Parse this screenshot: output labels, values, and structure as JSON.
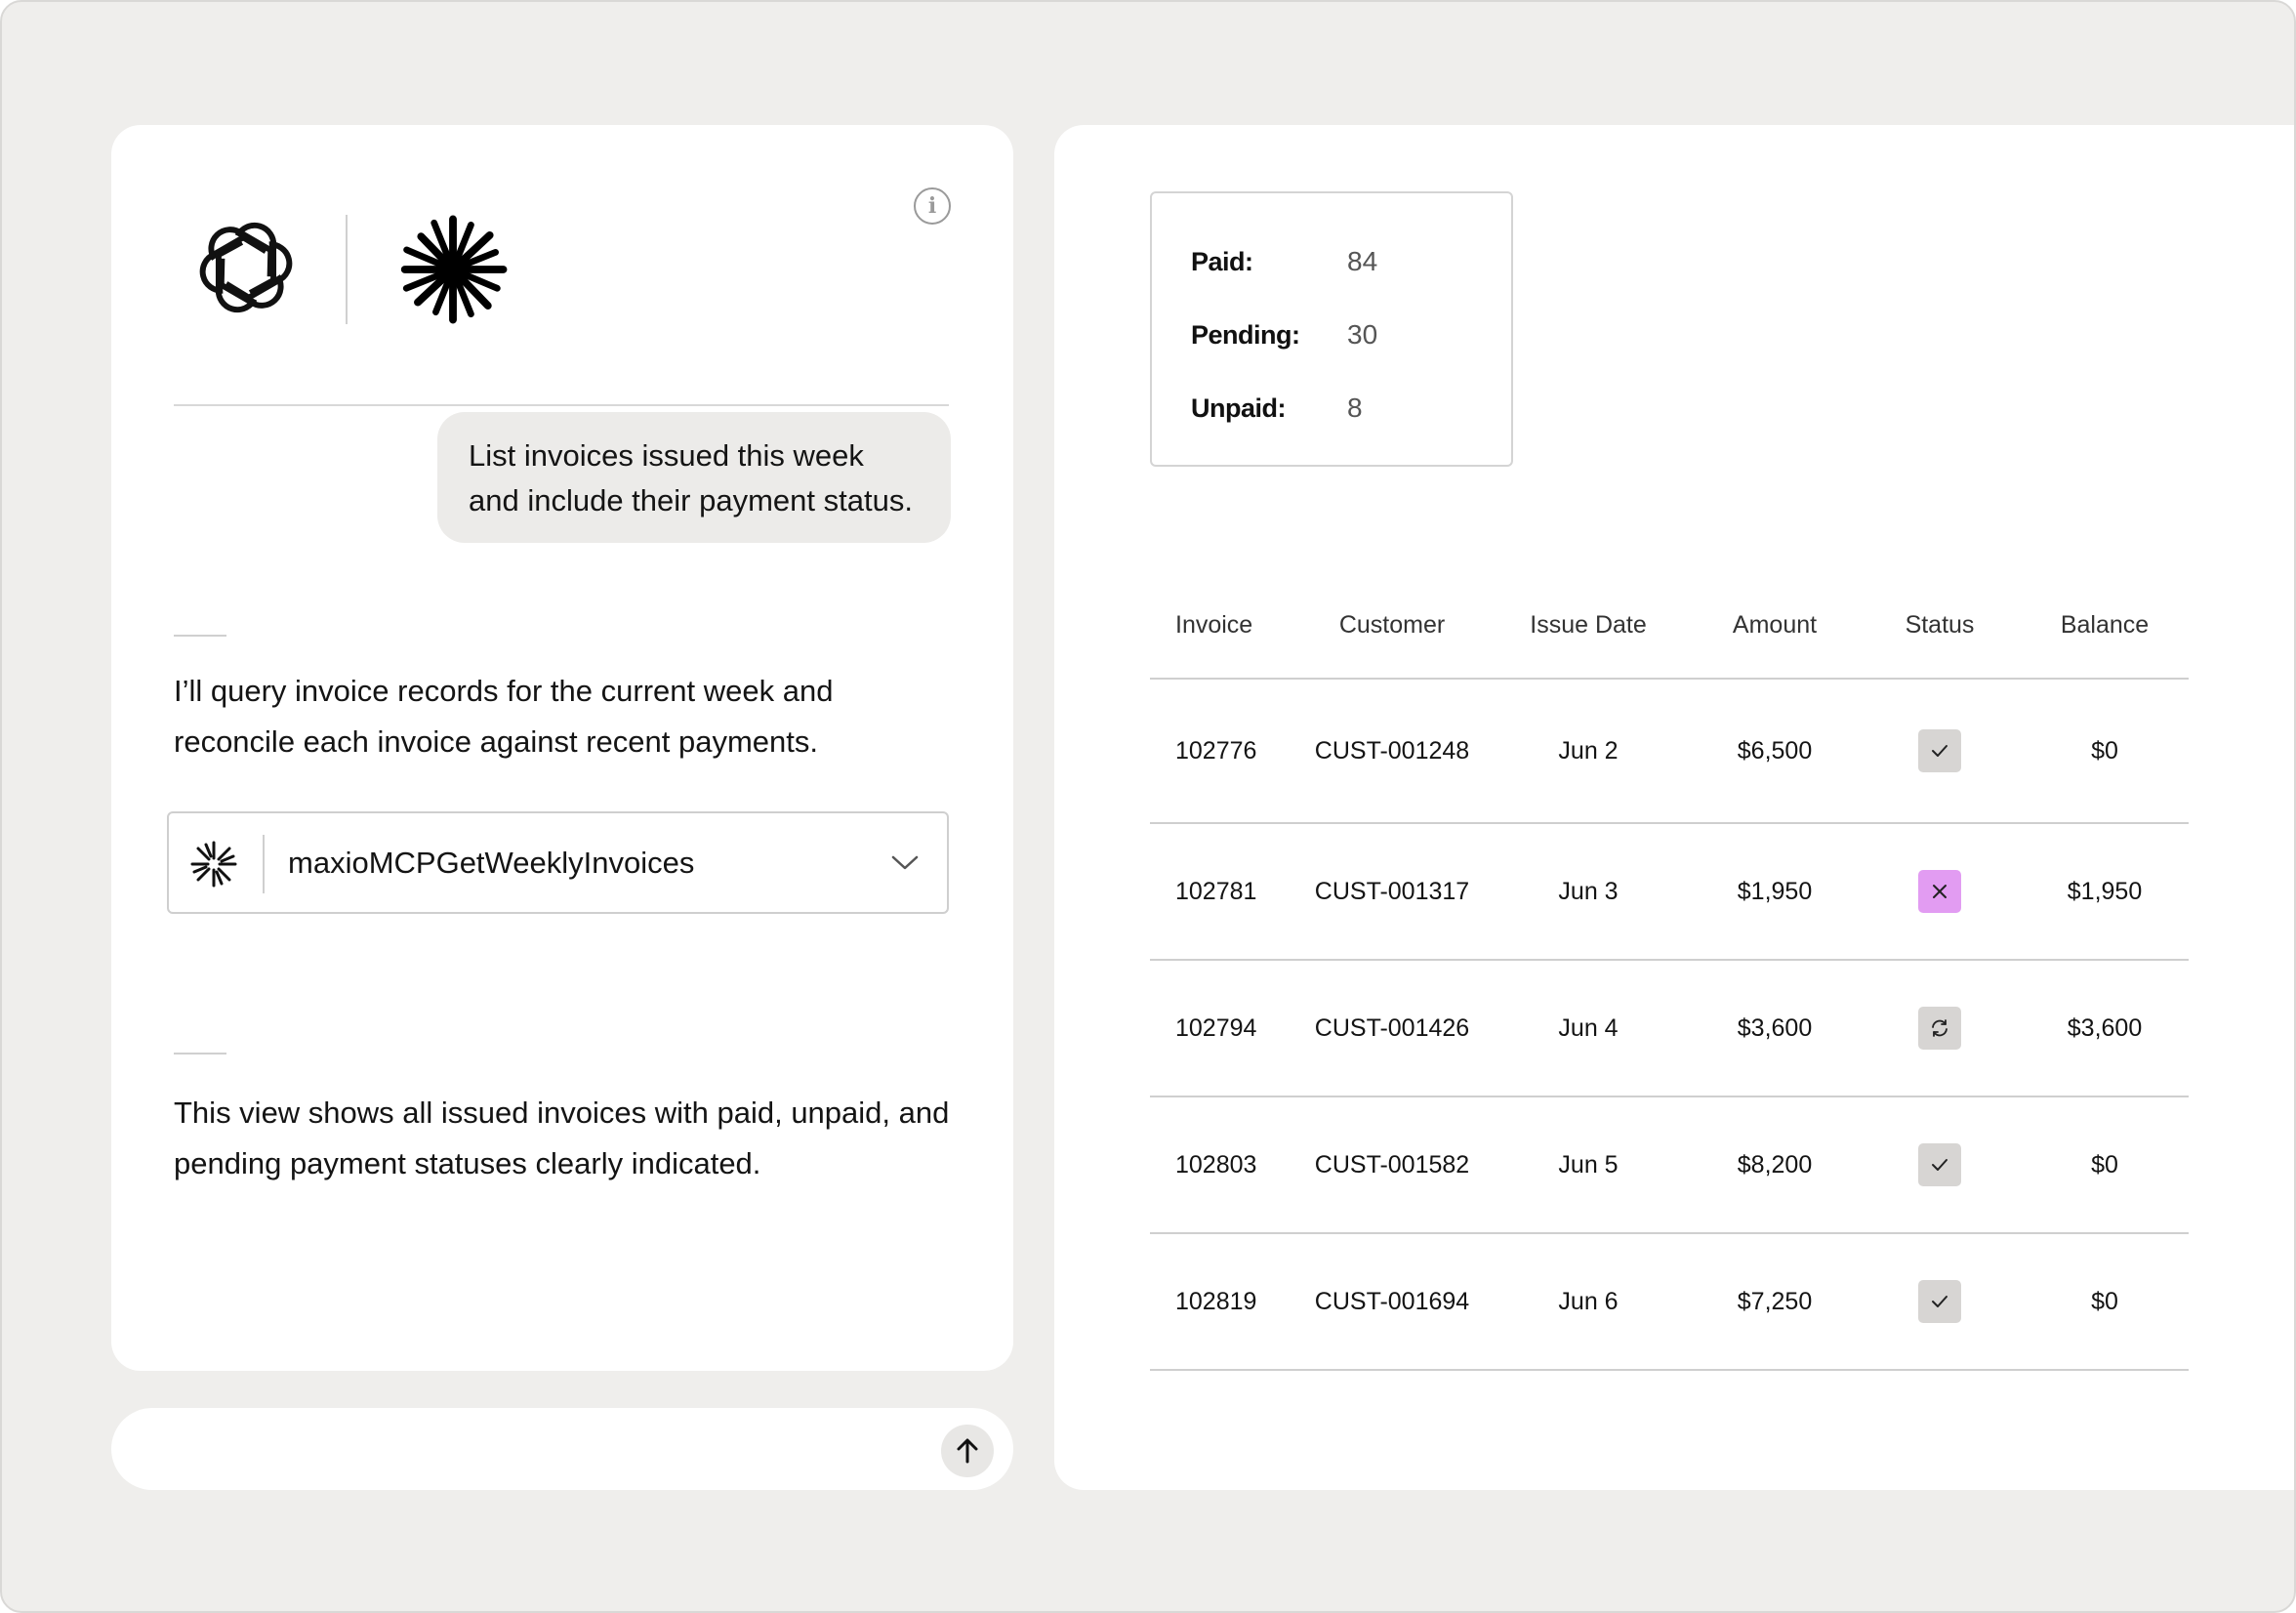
{
  "colors": {
    "frame_bg": "#efeeec",
    "panel_bg": "#ffffff",
    "bubble_bg": "#ecebe9",
    "status_paid": "#d7d5d3",
    "status_unpaid": "#e29cf2",
    "status_pending": "#d7d5d3"
  },
  "chat": {
    "logos": [
      "openai-logo",
      "claude-logo"
    ],
    "user_message": "List invoices issued this week and include their payment status.",
    "assistant_message_1": "I’ll query invoice records for the current week and reconcile each invoice against recent payments.",
    "tool_call": {
      "icon": "asterisk-icon",
      "name": "maxioMCPGetWeeklyInvoices",
      "chevron": "chevron-down-icon"
    },
    "assistant_message_2": "This view shows all issued invoices with paid, unpaid, and pending payment statuses clearly indicated."
  },
  "composer": {
    "value": "",
    "send_icon": "arrow-up-icon"
  },
  "summary": {
    "paid_label": "Paid:",
    "paid_value": "84",
    "pending_label": "Pending:",
    "pending_value": "30",
    "unpaid_label": "Unpaid:",
    "unpaid_value": "8"
  },
  "table": {
    "headers": [
      "Invoice",
      "Customer",
      "Issue Date",
      "Amount",
      "Status",
      "Balance"
    ],
    "rows": [
      {
        "invoice": "102776",
        "customer": "CUST-001248",
        "date": "Jun 2",
        "amount": "$6,500",
        "status": "paid",
        "balance": "$0"
      },
      {
        "invoice": "102781",
        "customer": "CUST-001317",
        "date": "Jun 3",
        "amount": "$1,950",
        "status": "unpaid",
        "balance": "$1,950"
      },
      {
        "invoice": "102794",
        "customer": "CUST-001426",
        "date": "Jun 4",
        "amount": "$3,600",
        "status": "pending",
        "balance": "$3,600"
      },
      {
        "invoice": "102803",
        "customer": "CUST-001582",
        "date": "Jun 5",
        "amount": "$8,200",
        "status": "paid",
        "balance": "$0"
      },
      {
        "invoice": "102819",
        "customer": "CUST-001694",
        "date": "Jun 6",
        "amount": "$7,250",
        "status": "paid",
        "balance": "$0"
      }
    ]
  }
}
